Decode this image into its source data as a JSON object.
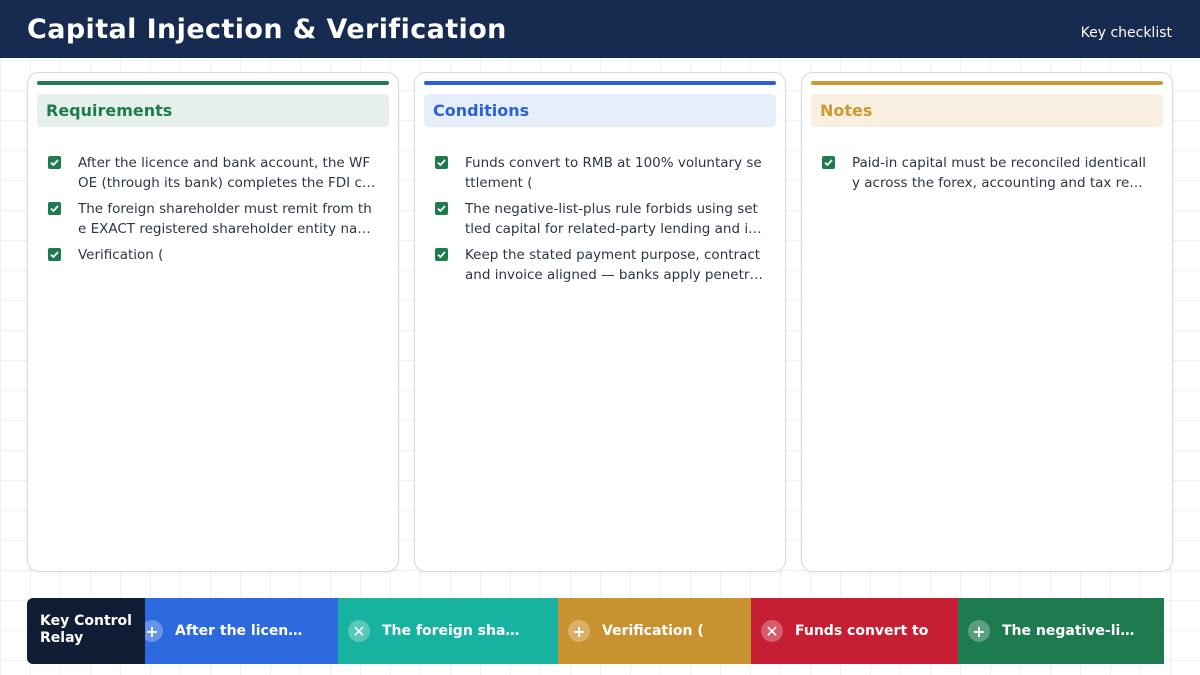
{
  "header": {
    "title": "Capital Injection & Verification",
    "subtitle": "Key checklist"
  },
  "colors": {
    "header_bg": "#172a4f",
    "requirements": "#1e7b4f",
    "conditions": "#2a62d6",
    "notes": "#cc9a34",
    "check": "#1e7b4f"
  },
  "columns": [
    {
      "title": "Requirements",
      "items": [
        "After the licence and bank account, the WFOE (through its bank) completes the FDI capital registration and foreign-exchange formalities before funds arrive",
        "The foreign shareholder must remit from the EXACT registered shareholder entity named in the articles and business licence",
        "Verification ("
      ]
    },
    {
      "title": "Conditions",
      "items": [
        "Funds convert to RMB at 100% voluntary settlement (",
        "The negative-list-plus rule forbids using settled capital for related-party lending and investment",
        "Keep the stated payment purpose, contract and invoice aligned — banks apply penetrating review"
      ]
    },
    {
      "title": "Notes",
      "items": [
        "Paid-in capital must be reconciled identically across the forex, accounting and tax records"
      ]
    }
  ],
  "relay": {
    "label": "Key Control Relay",
    "segments": [
      {
        "icon": "plus-icon",
        "glyph": "+",
        "text": "After the licen…",
        "color": "#2d6ae0"
      },
      {
        "icon": "close-icon",
        "glyph": "✕",
        "text": "The foreign sha…",
        "color": "#17b3a0"
      },
      {
        "icon": "plus-icon",
        "glyph": "+",
        "text": "Verification (",
        "color": "#c99230"
      },
      {
        "icon": "close-icon",
        "glyph": "✕",
        "text": "Funds convert to",
        "color": "#c61f33"
      },
      {
        "icon": "plus-icon",
        "glyph": "+",
        "text": "The negative-li…",
        "color": "#1e7b4f"
      }
    ]
  }
}
